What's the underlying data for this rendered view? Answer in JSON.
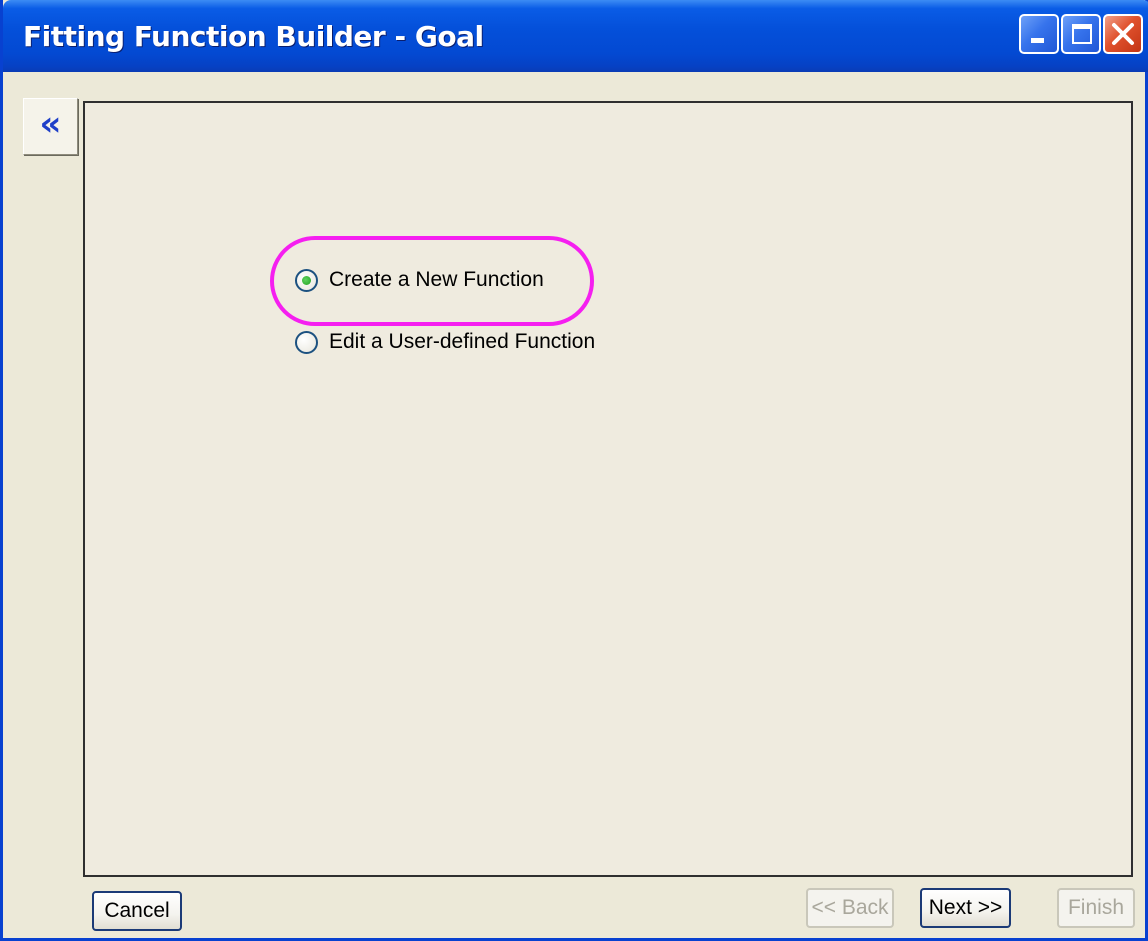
{
  "window": {
    "title": "Fitting Function Builder - Goal",
    "controls": {
      "minimize_icon": "minimize-icon",
      "maximize_icon": "maximize-icon",
      "close_icon": "close-icon"
    }
  },
  "sidebar_toggle": {
    "label": "«",
    "icon": "chevron-double-left-icon"
  },
  "options": [
    {
      "label": "Create a New Function",
      "selected": true
    },
    {
      "label": "Edit a User-defined Function",
      "selected": false
    }
  ],
  "buttons": {
    "cancel": "Cancel",
    "back": "<< Back",
    "next": "Next >>",
    "finish": "Finish"
  },
  "colors": {
    "titlebar": "#0450DA",
    "highlight": "#F51FF0",
    "radio_fill": "#21A121",
    "accent_blue": "#1F3FC8"
  }
}
